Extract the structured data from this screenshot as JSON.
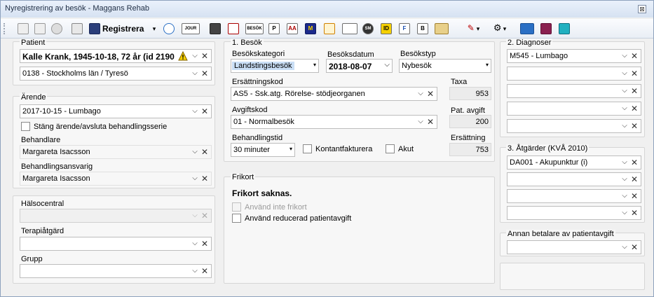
{
  "window": {
    "title": "Nyregistrering av besök  - Maggans Rehab",
    "close_glyph": "⊠"
  },
  "toolbar": {
    "register_label": "Registrera",
    "dropdown_arrow": "▾",
    "icons": [
      "copy-icon",
      "paste-icon",
      "cancel-icon",
      "print-icon",
      "save-icon",
      "refresh-icon",
      "journal-icon",
      "briefcase-icon",
      "edit-icon",
      "besok-icon",
      "p-icon",
      "aa-icon",
      "m-icon",
      "lightning-icon",
      "card-icon",
      "sm-icon",
      "id-icon",
      "fd-icon",
      "b-icon",
      "map-icon",
      "pen-icon",
      "settings-icon",
      "payment-icon",
      "book-icon",
      "document-icon"
    ],
    "icon_texts": {
      "journal": "JOUR",
      "besok": "BESÖK",
      "p": "P",
      "aa": "AA",
      "m": "M",
      "id": "ID",
      "fd": "F",
      "b": "B",
      "sm": "SM"
    }
  },
  "patient": {
    "group_title": "Patient",
    "name_value": "Kalle Krank, 1945-10-18, 72 år (id 2190",
    "municipality_value": "0138 - Stockholms län / Tyresö"
  },
  "arende": {
    "group_title": "Ärende",
    "case_value": "2017-10-15 - Lumbago",
    "close_case_label": "Stäng ärende/avsluta behandlingsserie",
    "behandlare_label": "Behandlare",
    "behandlare_value": "Margareta Isacsson",
    "ansvarig_label": "Behandlingsansvarig",
    "ansvarig_value": "Margareta Isacsson"
  },
  "lower_left": {
    "halsocentral_label": "Hälsocentral",
    "terapi_label": "Terapiåtgärd",
    "grupp_label": "Grupp"
  },
  "besok": {
    "group_title": "1. Besök",
    "kategori_label": "Besökskategori",
    "kategori_value": "Landstingsbesök",
    "datum_label": "Besöksdatum",
    "datum_value": "2018-08-07",
    "typ_label": "Besökstyp",
    "typ_value": "Nybesök",
    "ersattningskod_label": "Ersättningskod",
    "ersattningskod_value": "AS5 - Ssk.atg. Rörelse- stödjeorganen",
    "taxa_label": "Taxa",
    "taxa_value": "953",
    "avgiftskod_label": "Avgiftskod",
    "avgiftskod_value": "01 - Normalbesök",
    "pat_avgift_label": "Pat. avgift",
    "pat_avgift_value": "200",
    "behandlingstid_label": "Behandlingstid",
    "behandlingstid_value": "30 minuter",
    "kontant_label": "Kontantfakturera",
    "akut_label": "Akut",
    "ersattning_label": "Ersättning",
    "ersattning_value": "753"
  },
  "frikort": {
    "group_title": "Frikort",
    "status": "Frikort saknas.",
    "anvand_inte_label": "Använd inte frikort",
    "reducerad_label": "Använd reducerad patientavgift"
  },
  "diagnoser": {
    "group_title": "2. Diagnoser",
    "values": [
      "M545 - Lumbago",
      "",
      "",
      "",
      ""
    ]
  },
  "atgarder": {
    "group_title": "3. Åtgärder (KVÅ 2010)",
    "values": [
      "DA001 - Akupunktur (i)",
      "",
      "",
      ""
    ]
  },
  "annan_betalare": {
    "group_title": "Annan betalare av patientavgift"
  },
  "glyphs": {
    "chevron": "⌵",
    "clear": "✕",
    "arrow": "▾",
    "warning": "⚠"
  }
}
